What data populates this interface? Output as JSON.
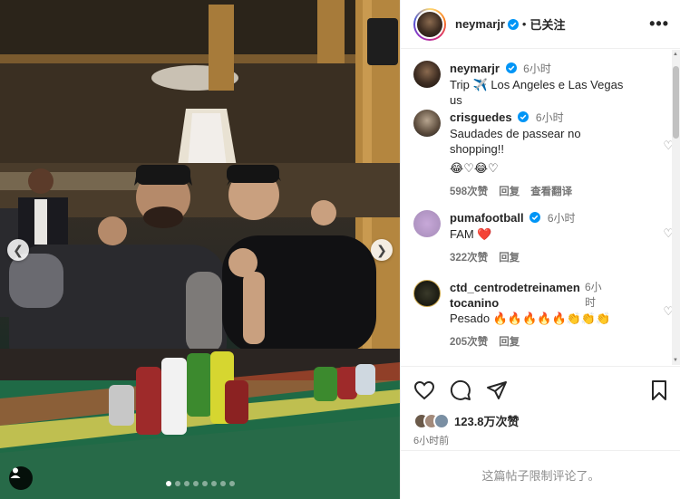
{
  "post": {
    "username": "neymarjr",
    "follow_status": "已关注",
    "more_icon": "more-horizontal-icon"
  },
  "caption": {
    "username": "neymarjr",
    "time": "6小时",
    "text": "Trip ✈️ Los Angeles e Las Vegas us"
  },
  "comments": [
    {
      "username": "crisguedes",
      "verified": true,
      "time": "6小时",
      "text": "Saudades de passear no shopping!!",
      "emoji": "😂♡😂♡",
      "likes": "598次赞",
      "reply": "回复",
      "translate": "查看翻译"
    },
    {
      "username": "pumafootball",
      "verified": true,
      "time": "6小时",
      "text": "FAM ❤️",
      "emoji": "",
      "likes": "322次赞",
      "reply": "回复",
      "translate": ""
    },
    {
      "username": "ctd_centrodetreinamentocanino",
      "verified": false,
      "time": "6小时",
      "text": "Pesado 🔥🔥🔥🔥🔥👏👏👏",
      "emoji": "",
      "likes": "205次赞",
      "reply": "回复",
      "translate": ""
    }
  ],
  "engagement": {
    "likes": "123.8万次赞",
    "time": "6小时前"
  },
  "comments_closed": "这篇帖子限制评论了。",
  "carousel": {
    "slides": 8,
    "active": 0
  },
  "colors": {
    "verified": "#0095f6",
    "text": "#262626",
    "muted": "#737373"
  }
}
